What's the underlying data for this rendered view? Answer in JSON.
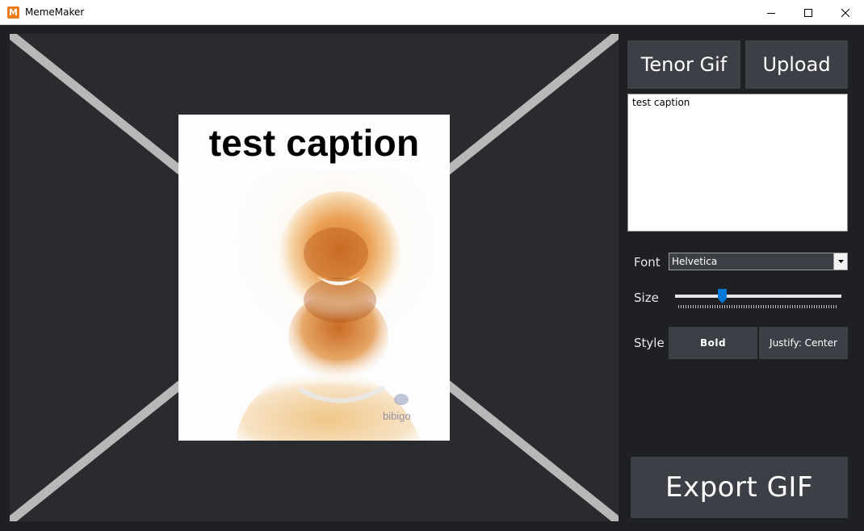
{
  "window": {
    "app_icon_letter": "M",
    "title": "MemeMaker",
    "controls": [
      "minimize",
      "maximize",
      "close"
    ]
  },
  "preview": {
    "caption": "test caption",
    "placeholder_icon": "x-cross-placeholder",
    "gif_icon": "gif-frame-person"
  },
  "toolbar": {
    "tenor_label": "Tenor Gif",
    "upload_label": "Upload"
  },
  "caption_input": {
    "value": "test caption"
  },
  "font": {
    "label": "Font",
    "selected": "Helvetica"
  },
  "size": {
    "label": "Size",
    "fraction": 0.28
  },
  "style": {
    "label": "Style",
    "bold_label": "Bold",
    "justify_label": "Justify: Center"
  },
  "export": {
    "label": "Export GIF"
  },
  "colors": {
    "accent": "#0078d7",
    "button": "#3d3f47",
    "background": "#1f2024",
    "canvas": "#2a2b2f"
  }
}
